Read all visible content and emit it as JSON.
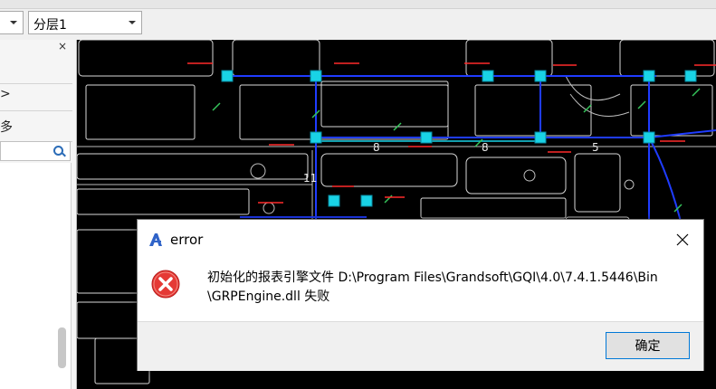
{
  "toolbar": {
    "combo1": {
      "value": ""
    },
    "combo2": {
      "value": "分层1"
    }
  },
  "left_panel": {
    "close_glyph": "×",
    "rows": [
      {
        "label": ""
      },
      {
        "label": ">"
      },
      {
        "label": "多"
      }
    ],
    "search": {
      "placeholder": ""
    }
  },
  "canvas": {
    "labels": [
      "8",
      "8",
      "5",
      "11"
    ],
    "accent_blue": "#1f3cff",
    "accent_cyan": "#19d3e6",
    "accent_red": "#ff2a2a",
    "accent_green": "#35c45a"
  },
  "dialog": {
    "title": "error",
    "message_line1": "初始化的报表引擎文件 D:\\Program Files\\Grandsoft\\GQI\\4.0\\7.4.1.5446\\Bin",
    "message_line2": "\\GRPEngine.dll 失败",
    "ok_label": "确定",
    "icons": {
      "app": "app-logo-icon",
      "error": "error-x-icon",
      "close": "close-icon"
    }
  }
}
